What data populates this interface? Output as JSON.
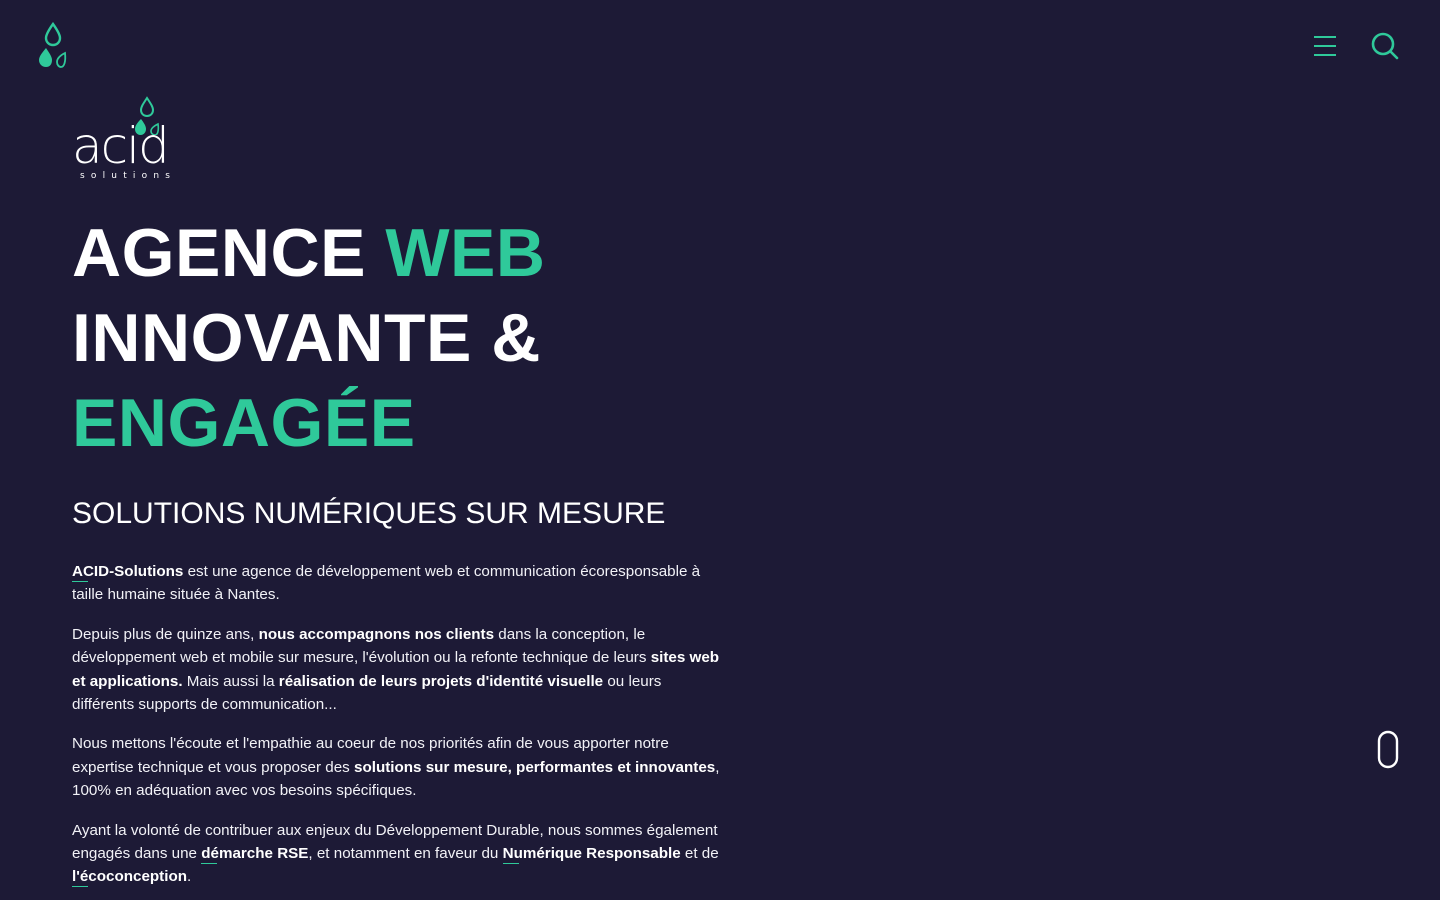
{
  "header": {
    "logo_icon": "leaf-drop-logo-icon",
    "menu_icon": "hamburger-menu-icon",
    "search_icon": "search-icon"
  },
  "brand": {
    "wordmark": "acid",
    "tagline": "solutions"
  },
  "hero": {
    "title_parts": [
      "AGENCE ",
      "WEB",
      "INNOVANTE &",
      "ENGAGÉE"
    ],
    "subtitle": "SOLUTIONS NUMÉRIQUES SUR MESURE"
  },
  "paragraphs": {
    "p1": {
      "link": "ACID-Solutions",
      "t1": " est une agence de développement web et communication écoresponsable à taille humaine située à Nantes."
    },
    "p2": {
      "t1": "Depuis plus de quinze ans, ",
      "b1": "nous accompagnons nos clients",
      "t2": " dans la conception, le développement web et mobile sur mesure, l'évolution ou la refonte technique de leurs ",
      "b2": "sites web et applications.",
      "t3": " Mais aussi la ",
      "b3": "réalisation de leurs projets d'identité visuelle",
      "t4": " ou leurs différents supports de communication..."
    },
    "p3": {
      "t1": "Nous mettons l'écoute et l'empathie au coeur de nos priorités afin de vous apporter notre expertise technique et vous proposer des ",
      "b1": "solutions sur mesure, performantes et innovantes",
      "t2": ", 100% en adéquation avec vos besoins spécifiques."
    },
    "p4": {
      "t1": "Ayant la volonté de contribuer aux enjeux du Développement Durable, nous sommes également engagés dans une ",
      "link1": "démarche RSE",
      "t2": ", et notamment en faveur du ",
      "link2": "Numérique Responsable",
      "t3": " et de ",
      "link3": "l'écoconception",
      "t4": "."
    }
  },
  "scroll_indicator": {
    "icon": "mouse-scroll-icon"
  },
  "colors": {
    "background": "#1d1a36",
    "accent": "#2fc99a",
    "text": "#ffffff"
  }
}
